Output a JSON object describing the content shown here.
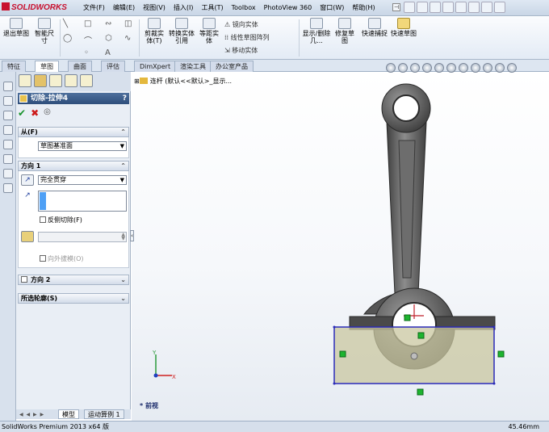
{
  "app": {
    "logo_text": "SOLIDWORKS",
    "menu": [
      "文件(F)",
      "编辑(E)",
      "视图(V)",
      "插入(I)",
      "工具(T)",
      "Toolbox",
      "PhotoView 360",
      "窗口(W)",
      "帮助(H)"
    ]
  },
  "commands": {
    "exit_sketch": "退出草图",
    "smart_dim": "智能尺寸",
    "trim": "剪裁实体(T)",
    "convert": "转换实体引用",
    "offset": "等距实体",
    "mirror": "镜向实体",
    "linear_pattern": "线性草图阵列",
    "move": "移动实体",
    "show_hide": "显示/删除几...",
    "repair": "修复草图",
    "quick_snap": "快速捕捉",
    "rapid_sketch": "快速草图"
  },
  "tabs": [
    "特征",
    "草图",
    "曲面",
    "评估",
    "DimXpert",
    "渲染工具",
    "办公室产品"
  ],
  "active_tab": "草图",
  "property_manager": {
    "title": "切除-拉伸4",
    "help": "?",
    "from_group": {
      "label": "从(F)",
      "value": "草图基准面"
    },
    "direction1": {
      "label": "方向 1",
      "end_condition": "完全贯穿",
      "flip_cut": "反侧切除(F)",
      "draft_outward": "向外拔模(O)"
    },
    "direction2": {
      "label": "方向 2"
    },
    "contours": {
      "label": "所选轮廓(S)"
    }
  },
  "model_tabs": [
    "模型",
    "运动算例 1"
  ],
  "feature_tree": {
    "root": "连杆 (默认<<默认>_显示..."
  },
  "view_name": "前视",
  "triad": {
    "x": "X",
    "y": "Y"
  },
  "status": {
    "left": "SolidWorks Premium 2013 x64 版",
    "right": "45.46mm"
  },
  "colors": {
    "accent": "#2e4e7b",
    "part": "#5d5d5d",
    "sketch_fill": "#c9c7a0",
    "sketch_line": "#2a2ab8",
    "relation": "#1db42f"
  }
}
